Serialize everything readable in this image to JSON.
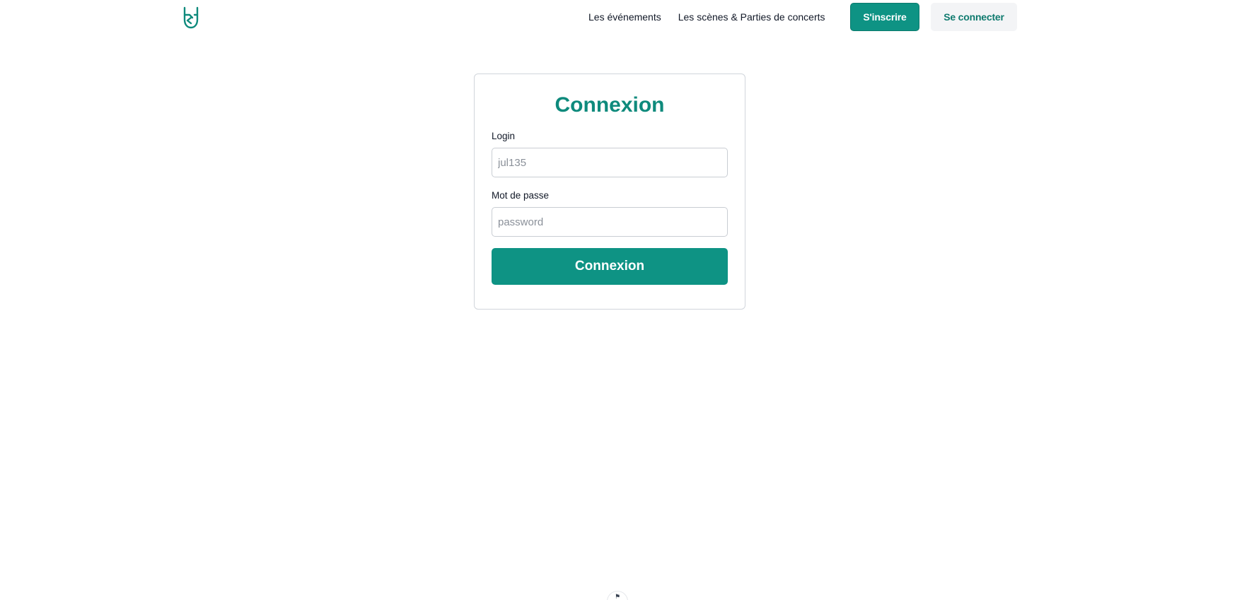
{
  "header": {
    "logo_icon": "rock-hand-icon",
    "nav": [
      {
        "label": "Les événements"
      },
      {
        "label": "Les scènes & Parties de concerts"
      }
    ],
    "signup_label": "S'inscrire",
    "login_label": "Se connecter"
  },
  "login_form": {
    "title": "Connexion",
    "login_label": "Login",
    "login_placeholder": "jul135",
    "login_value": "",
    "password_label": "Mot de passe",
    "password_placeholder": "password",
    "password_value": "",
    "submit_label": "Connexion"
  },
  "footer": {
    "badge_icon": "flag-icon"
  },
  "colors": {
    "primary": "#0e9384",
    "title": "#0e8a7c",
    "secondary_button_bg": "#f3f4f6"
  }
}
